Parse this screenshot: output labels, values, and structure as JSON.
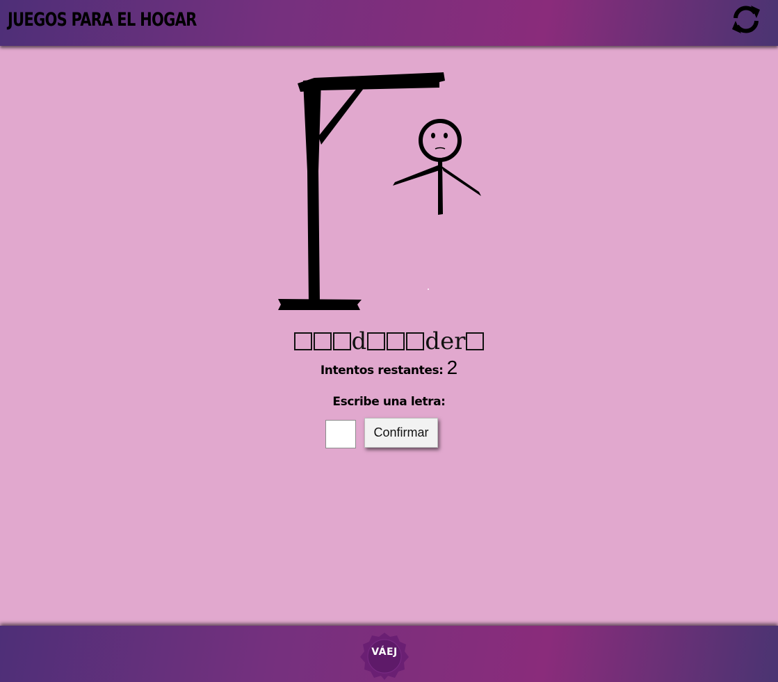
{
  "header": {
    "title": "Juegos para el hogar",
    "refresh_icon": "refresh-icon"
  },
  "game": {
    "word_display": [
      "",
      "",
      "",
      "d",
      "",
      "",
      "",
      "d",
      "e",
      "r",
      ""
    ],
    "attempts_label": "Intentos restantes:",
    "attempts_remaining": "2",
    "prompt_label": "Escribe una letra:",
    "letter_input_value": "",
    "confirm_label": "Confirmar"
  },
  "footer": {
    "logo_text": "VÁEJ"
  },
  "colors": {
    "background": "#e1a8ce",
    "bar_gradient_start": "#4e2f78",
    "bar_gradient_mid": "#8a2c7b",
    "logo_fill": "#6a1f73"
  }
}
